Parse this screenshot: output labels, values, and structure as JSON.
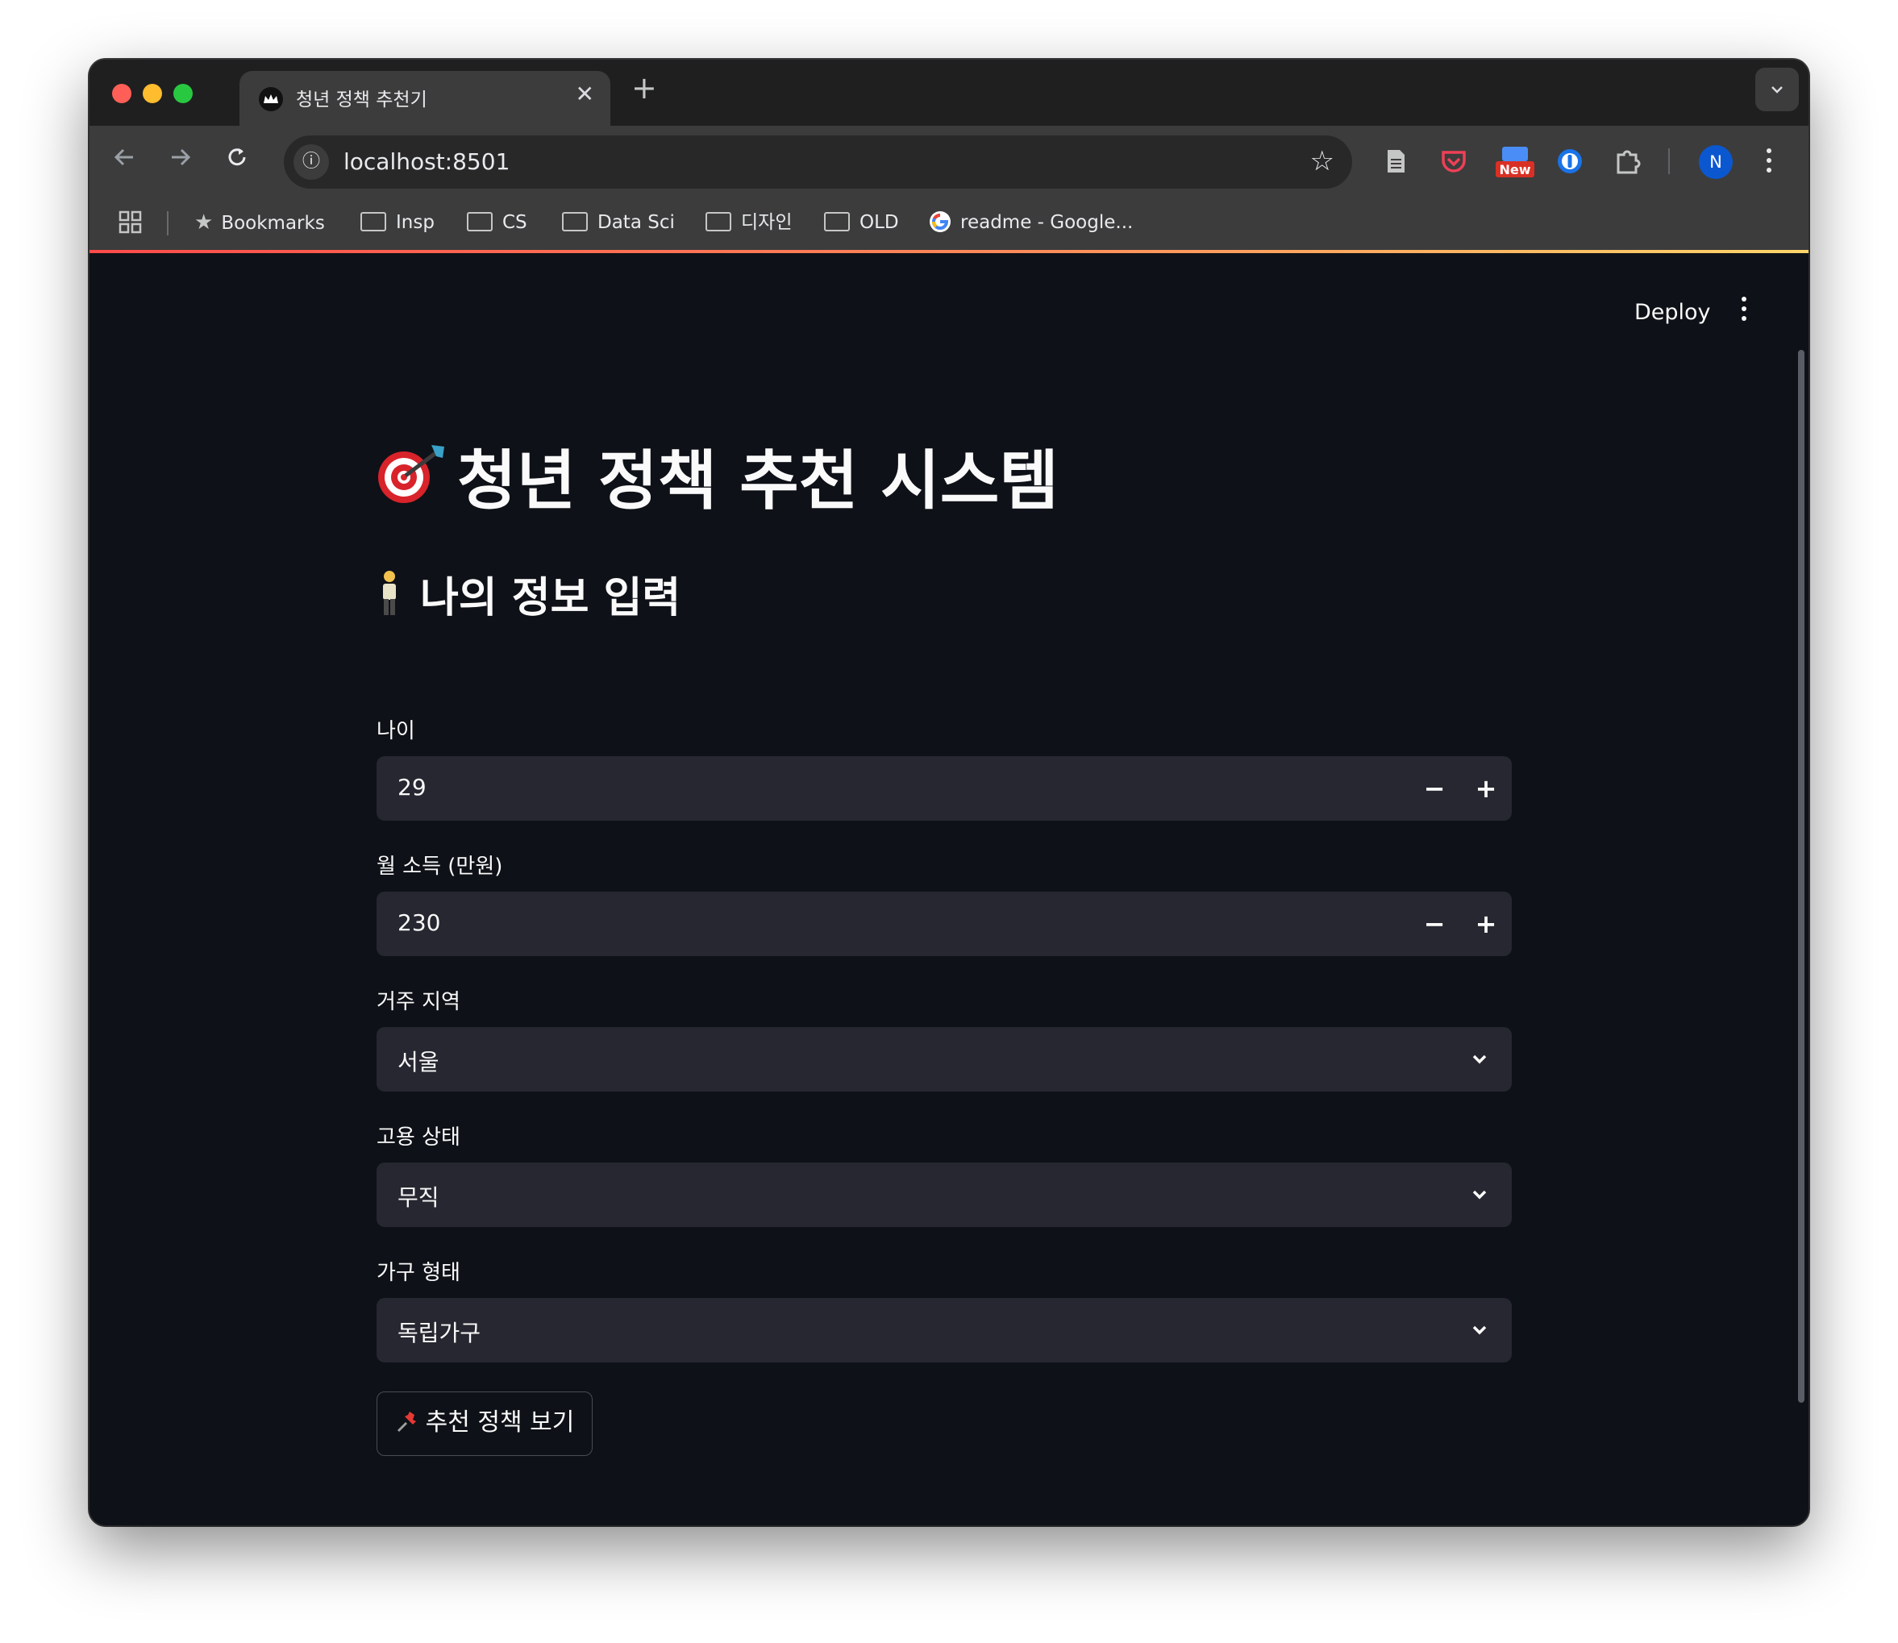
{
  "browser": {
    "tab_title": "청년 정책 추천기",
    "url": "localhost:8501",
    "extension_badge": "New",
    "profile_initial": "N",
    "bookmarks": [
      {
        "label": "Bookmarks",
        "type": "star"
      },
      {
        "label": "Insp",
        "type": "folder"
      },
      {
        "label": "CS",
        "type": "folder"
      },
      {
        "label": "Data Sci",
        "type": "folder"
      },
      {
        "label": "디자인",
        "type": "folder"
      },
      {
        "label": "OLD",
        "type": "folder"
      },
      {
        "label": "readme - Google...",
        "type": "google"
      }
    ]
  },
  "app": {
    "deploy_label": "Deploy",
    "title": "청년 정책 추천 시스템",
    "title_icon": "dart-target-emoji",
    "subtitle": "나의 정보 입력",
    "subtitle_icon": "person-standing-emoji",
    "fields": {
      "age": {
        "label": "나이",
        "value": "29"
      },
      "income": {
        "label": "월 소득 (만원)",
        "value": "230"
      },
      "region": {
        "label": "거주 지역",
        "value": "서울"
      },
      "employment": {
        "label": "고용 상태",
        "value": "무직"
      },
      "household": {
        "label": "가구 형태",
        "value": "독립가구"
      }
    },
    "submit_icon": "pushpin-emoji",
    "submit_label": "추천 정책 보기"
  },
  "colors": {
    "app_background": "#0e1117",
    "input_background": "#262730",
    "text": "#fafafa",
    "traffic_red": "#ff5f57",
    "traffic_yellow": "#febc2e",
    "traffic_green": "#28c840",
    "accent_gradient_start": "#ff4b4b",
    "accent_gradient_end": "#fdd66a"
  }
}
